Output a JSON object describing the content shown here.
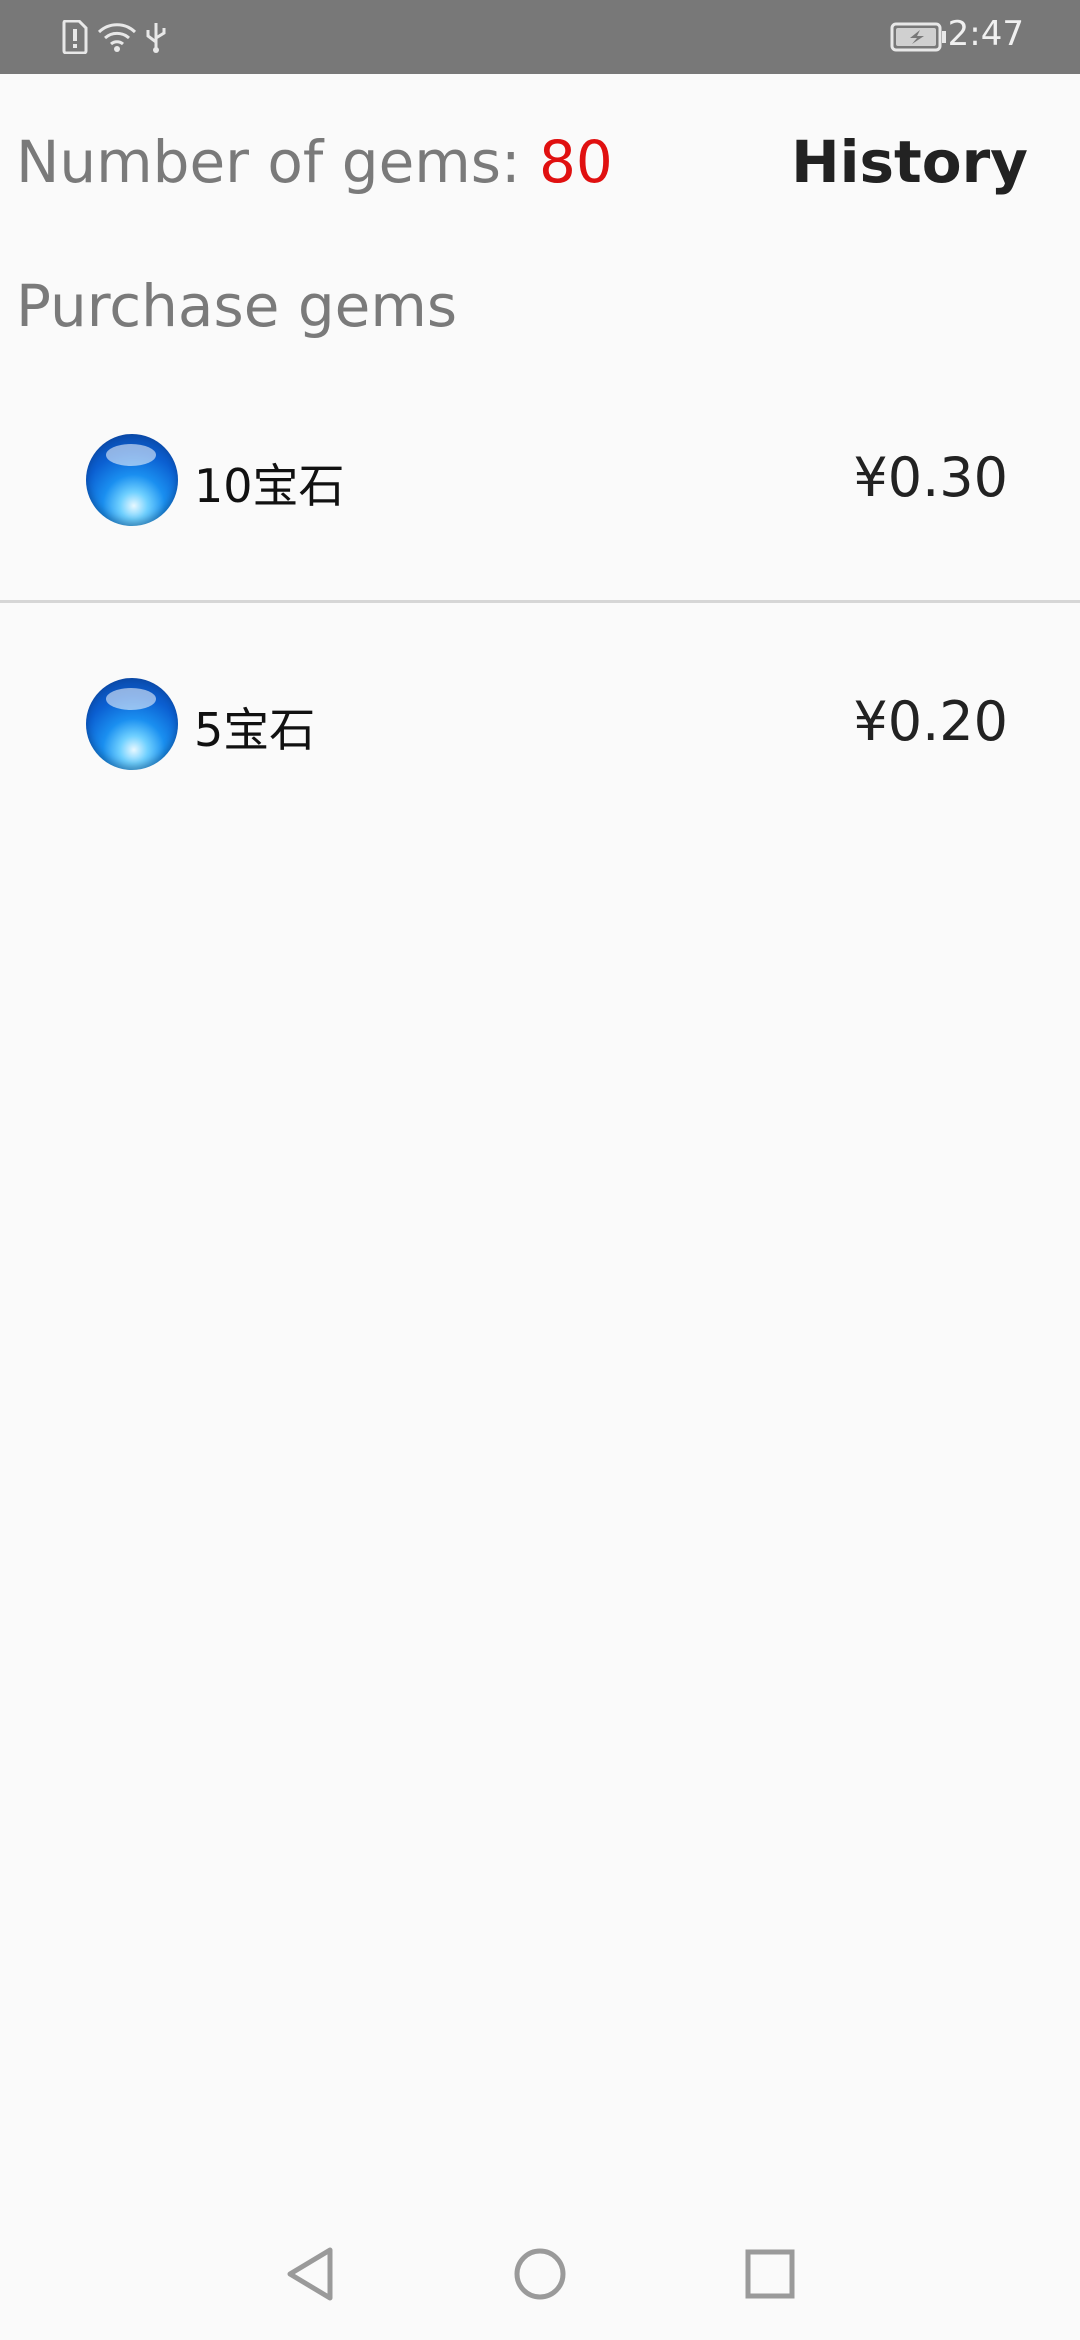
{
  "status_bar": {
    "time": "2:47",
    "icons": [
      "sim-alert-icon",
      "wifi-icon",
      "usb-icon",
      "battery-charging-icon"
    ]
  },
  "header": {
    "gems_label": "Number of gems: ",
    "gems_value": "80",
    "history_label": "History"
  },
  "purchase": {
    "title": "Purchase gems",
    "items": [
      {
        "name": "10宝石",
        "price": "¥0.30",
        "icon": "gem-icon"
      },
      {
        "name": "5宝石",
        "price": "¥0.20",
        "icon": "gem-icon"
      }
    ]
  },
  "nav": {
    "buttons": [
      "back-icon",
      "home-icon",
      "recents-icon"
    ]
  },
  "colors": {
    "status_bar": "#787878",
    "gems_value": "#e01010",
    "background": "#fafafa",
    "gem_blue": "#0b5fd1"
  }
}
